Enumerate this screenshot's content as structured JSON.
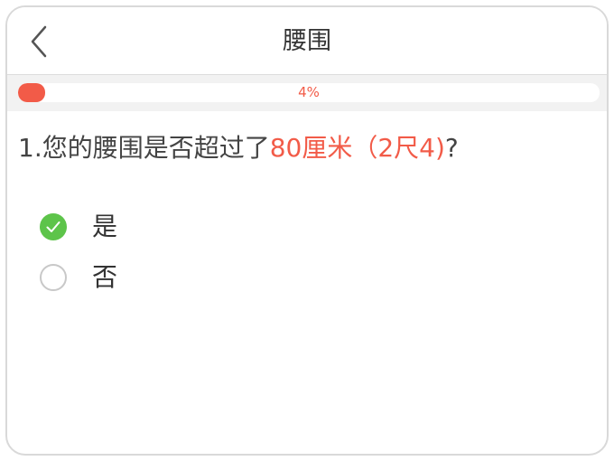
{
  "header": {
    "title": "腰围",
    "back_icon": "chevron-left-icon"
  },
  "progress": {
    "text": "4%",
    "value": 0.04,
    "color": "#f25b48"
  },
  "question": {
    "prefix": "1.您的腰围是否超过了",
    "highlight": "80厘米（2尺4)",
    "suffix": "?",
    "highlight_color": "#f25b48"
  },
  "options": [
    {
      "label": "是",
      "selected": true
    },
    {
      "label": "否",
      "selected": false
    }
  ],
  "colors": {
    "accent": "#f25b48",
    "check_green": "#5dc44a"
  }
}
